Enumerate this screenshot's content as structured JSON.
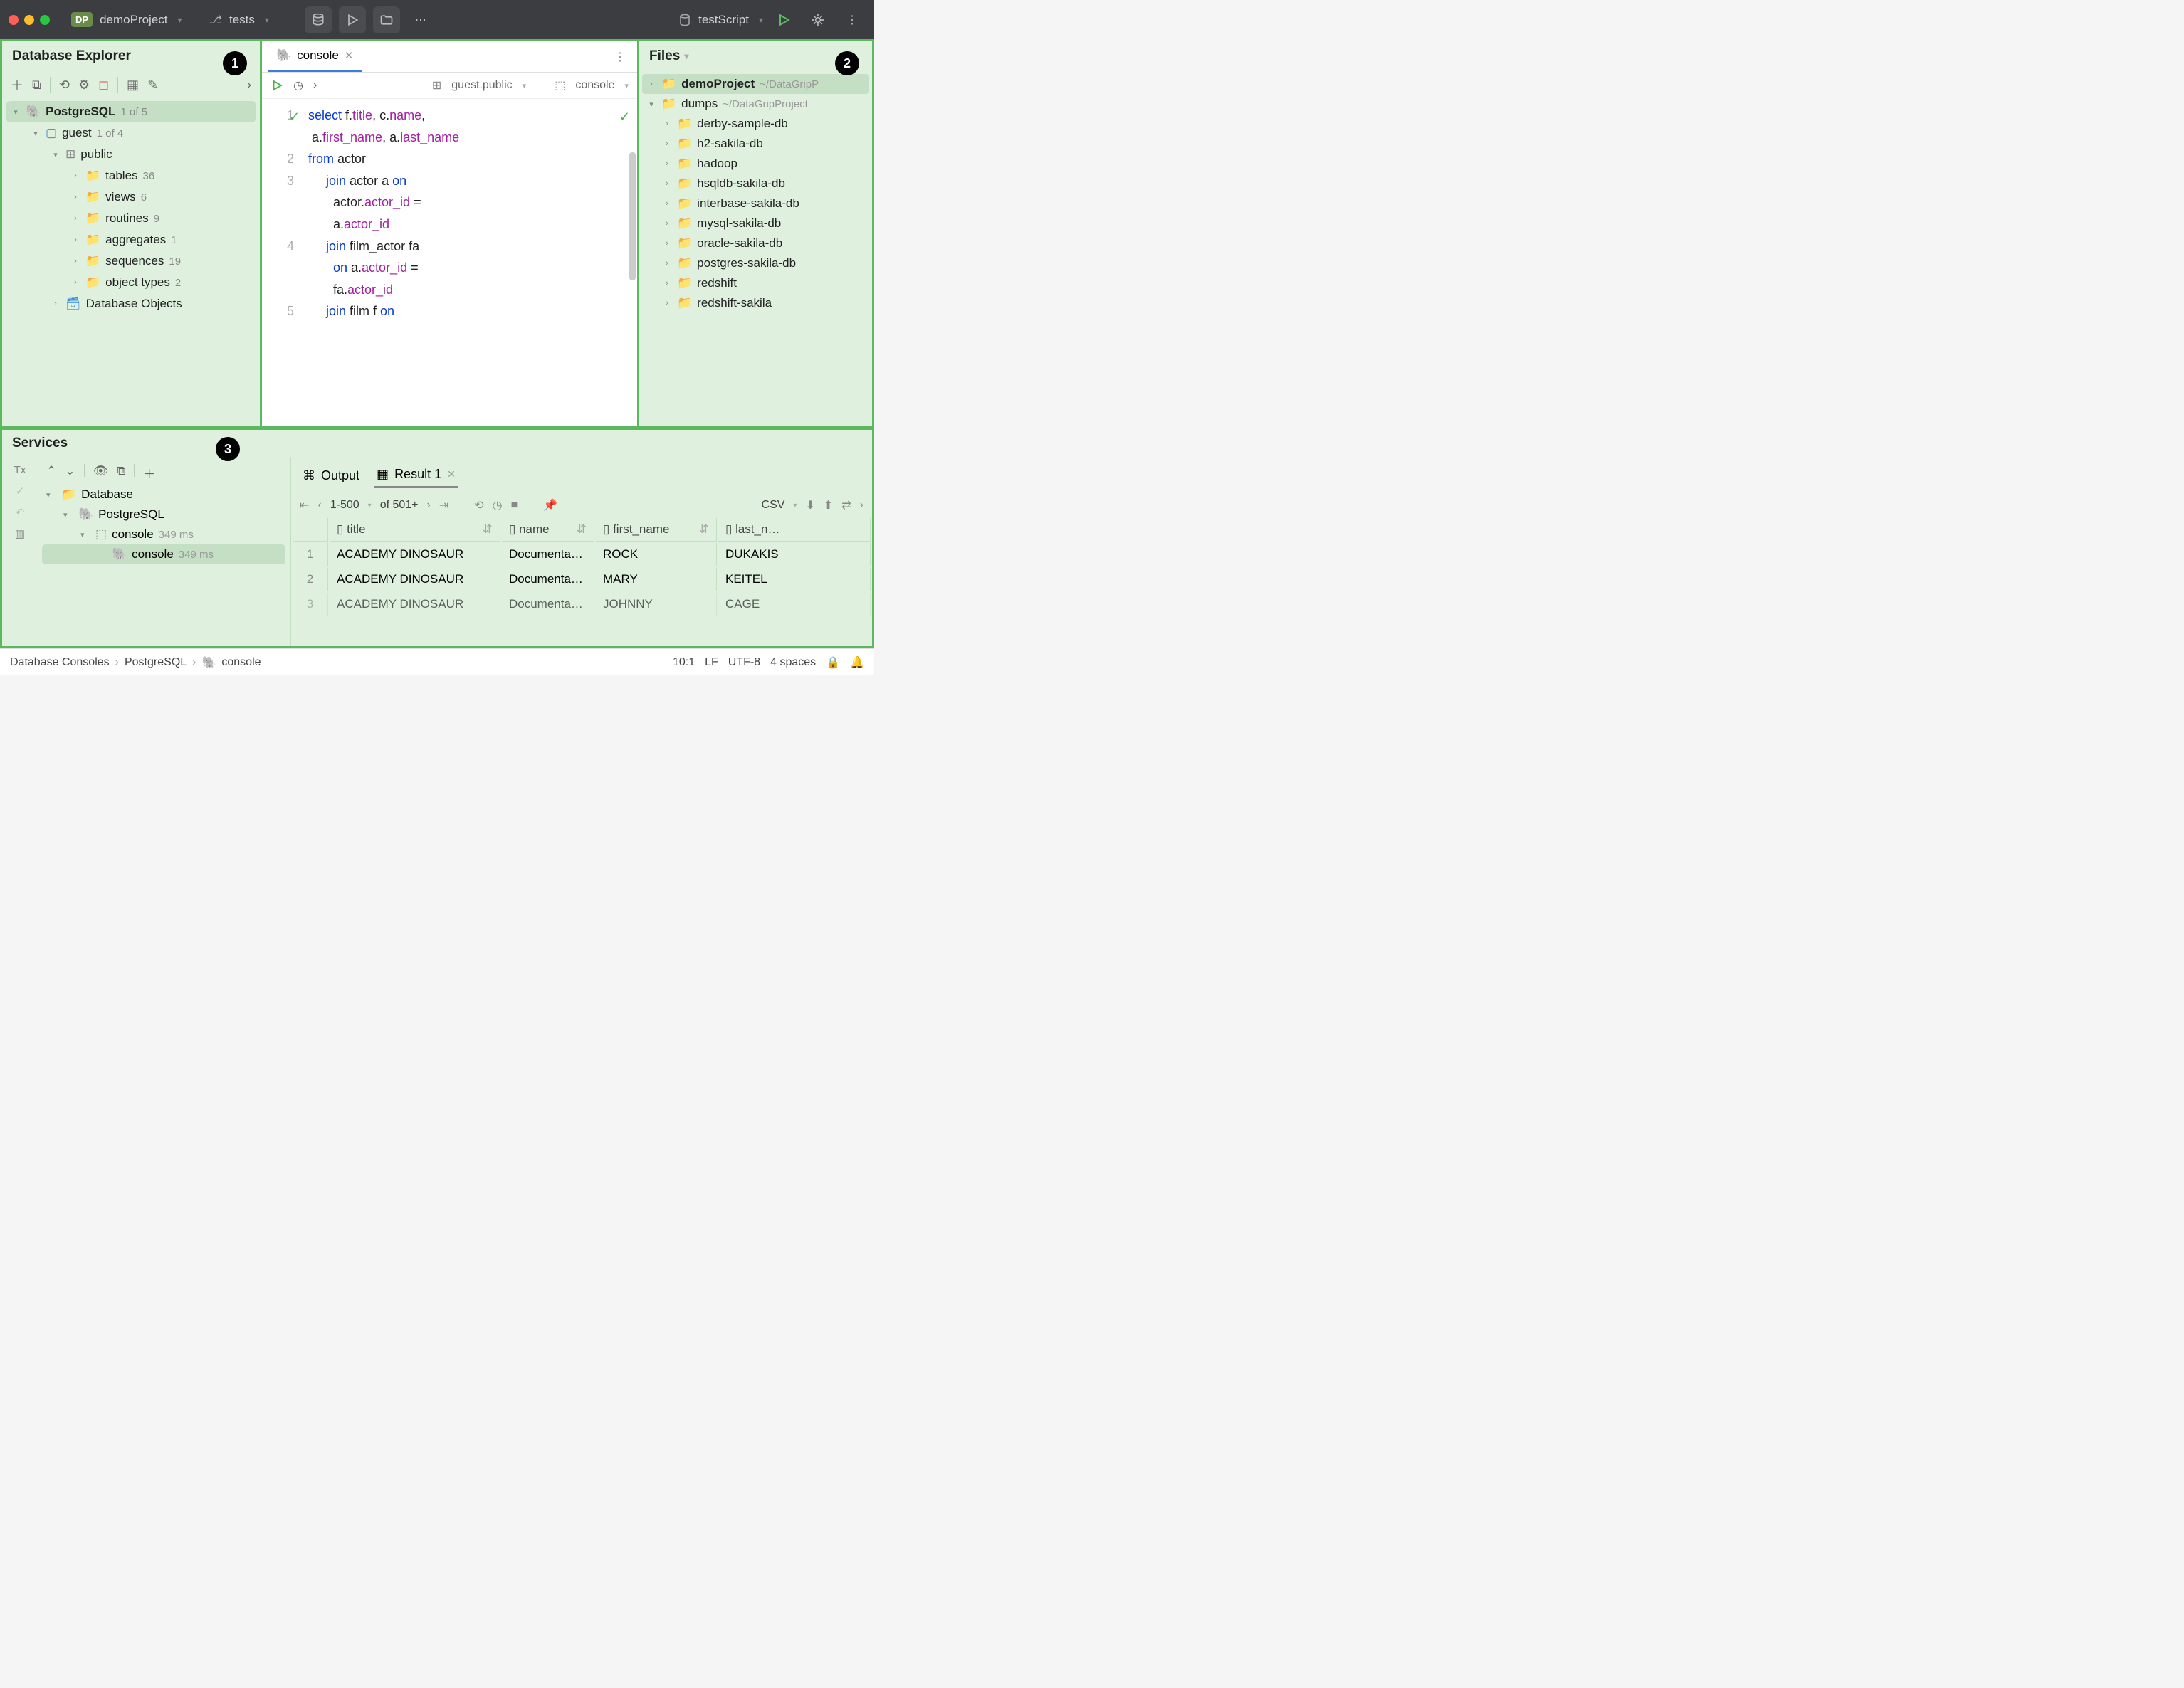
{
  "titlebar": {
    "project_badge": "DP",
    "project": "demoProject",
    "branch": "tests",
    "run_config": "testScript"
  },
  "db_explorer": {
    "title": "Database Explorer",
    "callout": "1",
    "root": {
      "label": "PostgreSQL",
      "count": "1 of 5"
    },
    "db": {
      "label": "guest",
      "count": "1 of 4"
    },
    "schema": {
      "label": "public"
    },
    "items": [
      {
        "label": "tables",
        "count": "36"
      },
      {
        "label": "views",
        "count": "6"
      },
      {
        "label": "routines",
        "count": "9"
      },
      {
        "label": "aggregates",
        "count": "1"
      },
      {
        "label": "sequences",
        "count": "19"
      },
      {
        "label": "object types",
        "count": "2"
      }
    ],
    "db_objects": "Database Objects"
  },
  "editor": {
    "tab": "console",
    "schema_sel": "guest.public",
    "console_sel": "console",
    "code_lines": [
      "1",
      "2",
      "3",
      "4",
      "5"
    ],
    "code": {
      "l1a": "select",
      "l1b": " f.",
      "l1c": "title",
      "l1d": ", c.",
      "l1e": "name",
      "l1f": ",",
      "l1g": " a.",
      "l1h": "first_name",
      "l1i": ", a.",
      "l1j": "last_name",
      "l2a": "from",
      "l2b": " actor",
      "l3a": "join",
      "l3b": " actor a ",
      "l3c": "on",
      "l3d": "       actor.",
      "l3e": "actor_id",
      "l3f": " =",
      "l3g": "       a.",
      "l3h": "actor_id",
      "l4a": "join",
      "l4b": " film_actor fa",
      "l4c": "       on",
      "l4d": " a.",
      "l4e": "actor_id",
      "l4f": " =",
      "l4g": "       fa.",
      "l4h": "actor_id",
      "l5a": "join",
      "l5b": " film f ",
      "l5c": "on"
    }
  },
  "files": {
    "title": "Files",
    "callout": "2",
    "proj": {
      "label": "demoProject",
      "path": "~/DataGripP"
    },
    "dumps": {
      "label": "dumps",
      "path": "~/DataGripProject"
    },
    "items": [
      "derby-sample-db",
      "h2-sakila-db",
      "hadoop",
      "hsqldb-sakila-db",
      "interbase-sakila-db",
      "mysql-sakila-db",
      "oracle-sakila-db",
      "postgres-sakila-db",
      "redshift",
      "redshift-sakila"
    ]
  },
  "services": {
    "title": "Services",
    "callout": "3",
    "tx_label": "Tx",
    "tree": {
      "db": "Database",
      "pg": "PostgreSQL",
      "console": "console",
      "time": "349 ms",
      "console2": "console",
      "time2": "349 ms"
    },
    "tabs": {
      "output": "Output",
      "result": "Result 1"
    },
    "pager": {
      "range": "1-500",
      "of": "of 501+",
      "format": "CSV"
    },
    "table": {
      "cols": [
        "title",
        "name",
        "first_name",
        "last_n…"
      ],
      "rows": [
        {
          "n": "1",
          "title": "ACADEMY DINOSAUR",
          "name": "Documenta…",
          "first": "ROCK",
          "last": "DUKAKIS"
        },
        {
          "n": "2",
          "title": "ACADEMY DINOSAUR",
          "name": "Documenta…",
          "first": "MARY",
          "last": "KEITEL"
        },
        {
          "n": "3",
          "title": "ACADEMY DINOSAUR",
          "name": "Documenta…",
          "first": "JOHNNY",
          "last": "CAGE"
        }
      ]
    }
  },
  "statusbar": {
    "crumbs": [
      "Database Consoles",
      "PostgreSQL",
      "console"
    ],
    "pos": "10:1",
    "eol": "LF",
    "enc": "UTF-8",
    "indent": "4 spaces"
  }
}
